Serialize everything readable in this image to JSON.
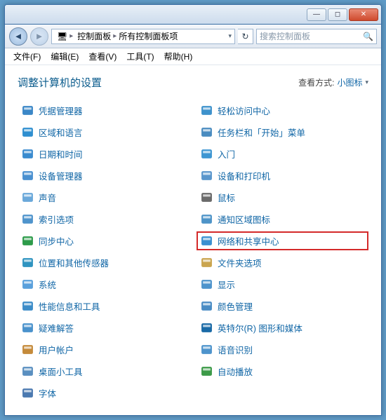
{
  "titlebar": {
    "min": "—",
    "max": "◻",
    "close": "✕"
  },
  "nav": {
    "back": "◄",
    "fwd": "►"
  },
  "breadcrumb": {
    "seg1": "控制面板",
    "seg2": "所有控制面板项"
  },
  "search": {
    "placeholder": "搜索控制面板"
  },
  "menus": {
    "file": "文件(F)",
    "edit": "编辑(E)",
    "view": "查看(V)",
    "tools": "工具(T)",
    "help": "帮助(H)"
  },
  "heading": "调整计算机的设置",
  "viewby": {
    "label": "查看方式:",
    "mode": "小图标"
  },
  "left_items": [
    {
      "name": "credential-manager",
      "label": "凭据管理器"
    },
    {
      "name": "region-language",
      "label": "区域和语言"
    },
    {
      "name": "date-time",
      "label": "日期和时间"
    },
    {
      "name": "device-manager",
      "label": "设备管理器"
    },
    {
      "name": "sound",
      "label": "声音"
    },
    {
      "name": "indexing-options",
      "label": "索引选项"
    },
    {
      "name": "sync-center",
      "label": "同步中心"
    },
    {
      "name": "location-sensors",
      "label": "位置和其他传感器"
    },
    {
      "name": "system",
      "label": "系统"
    },
    {
      "name": "performance-info",
      "label": "性能信息和工具"
    },
    {
      "name": "troubleshooting",
      "label": "疑难解答"
    },
    {
      "name": "user-accounts",
      "label": "用户帐户"
    },
    {
      "name": "desktop-gadgets",
      "label": "桌面小工具"
    },
    {
      "name": "fonts",
      "label": "字体"
    }
  ],
  "right_items": [
    {
      "name": "ease-of-access",
      "label": "轻松访问中心"
    },
    {
      "name": "taskbar-start",
      "label": "任务栏和「开始」菜单"
    },
    {
      "name": "getting-started",
      "label": "入门"
    },
    {
      "name": "devices-printers",
      "label": "设备和打印机"
    },
    {
      "name": "mouse",
      "label": "鼠标"
    },
    {
      "name": "notification-icons",
      "label": "通知区域图标"
    },
    {
      "name": "network-sharing",
      "label": "网络和共享中心",
      "highlight": true
    },
    {
      "name": "folder-options",
      "label": "文件夹选项"
    },
    {
      "name": "display",
      "label": "显示"
    },
    {
      "name": "color-management",
      "label": "颜色管理"
    },
    {
      "name": "intel-graphics",
      "label": "英特尔(R) 图形和媒体"
    },
    {
      "name": "speech-recognition",
      "label": "语音识别"
    },
    {
      "name": "autoplay",
      "label": "自动播放"
    }
  ]
}
